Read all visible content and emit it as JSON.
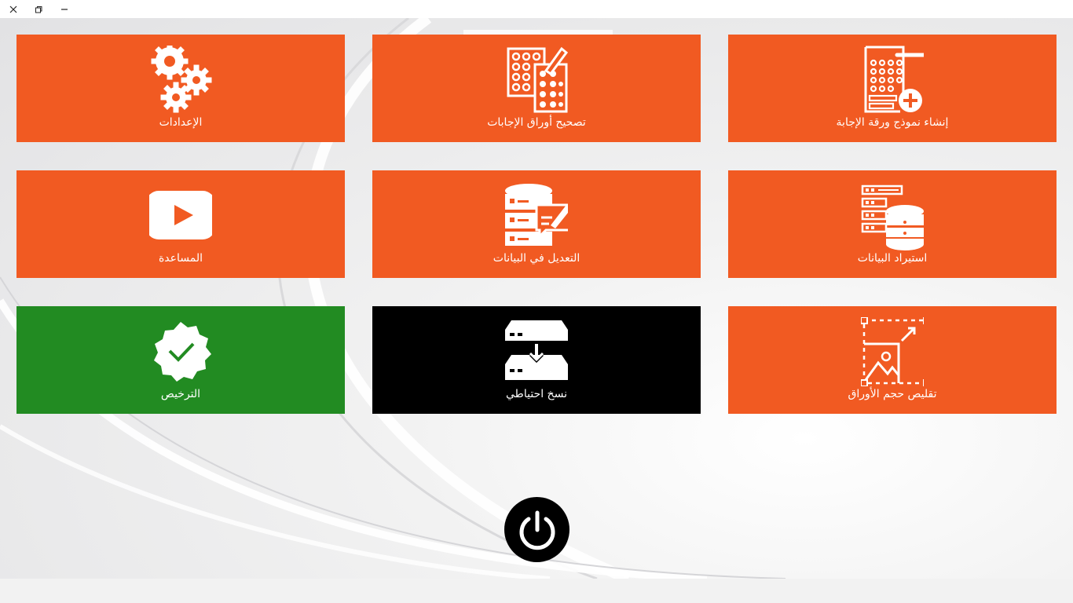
{
  "window": {
    "controls": {
      "close": "close",
      "restore": "restore",
      "minimize": "minimize"
    }
  },
  "colors": {
    "tile_orange": "#F15A22",
    "tile_green": "#228B22",
    "tile_black": "#000000",
    "icon_white": "#FFFFFF"
  },
  "tiles": [
    {
      "label": "الإعدادات",
      "icon": "gears-icon",
      "color": "#F15A22"
    },
    {
      "label": "تصحيح أوراق الإجابات",
      "icon": "answer-sheets-pencil-icon",
      "color": "#F15A22"
    },
    {
      "label": "إنشاء نموذج ورقة الإجابة",
      "icon": "answer-sheet-add-icon",
      "color": "#F15A22"
    },
    {
      "label": "المساعدة",
      "icon": "video-play-icon",
      "color": "#F15A22"
    },
    {
      "label": "التعديل  في البيانات",
      "icon": "database-edit-icon",
      "color": "#F15A22"
    },
    {
      "label": "استيراد البيانات",
      "icon": "database-import-icon",
      "color": "#F15A22"
    },
    {
      "label": "الترخيص",
      "icon": "verified-badge-icon",
      "color": "#228B22"
    },
    {
      "label": "نسخ احتياطي",
      "icon": "server-backup-icon",
      "color": "#000000"
    },
    {
      "label": "تقليص حجم الأوراق",
      "icon": "image-resize-icon",
      "color": "#F15A22"
    }
  ],
  "power": {
    "icon": "power-icon"
  }
}
